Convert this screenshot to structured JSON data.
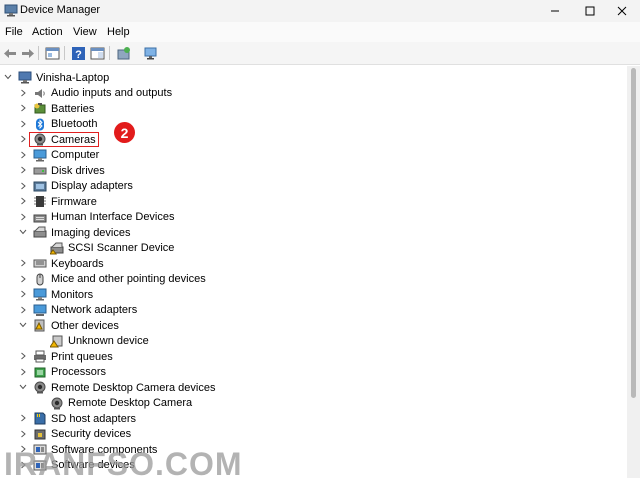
{
  "window": {
    "title": "Device Manager"
  },
  "menu": [
    "File",
    "Action",
    "View",
    "Help"
  ],
  "toolbar": [
    "back-arrow-icon",
    "forward-arrow-icon",
    "properties-pane-icon",
    "help-icon",
    "console-pane-icon",
    "update-driver-icon",
    "scan-hardware-icon"
  ],
  "tree": {
    "root": "Vinisha-Laptop",
    "items": [
      {
        "label": "Audio inputs and outputs",
        "icon": "speaker-icon"
      },
      {
        "label": "Batteries",
        "icon": "battery-icon"
      },
      {
        "label": "Bluetooth",
        "icon": "bluetooth-icon"
      },
      {
        "label": "Cameras",
        "icon": "camera-icon"
      },
      {
        "label": "Computer",
        "icon": "monitor-icon"
      },
      {
        "label": "Disk drives",
        "icon": "disk-icon"
      },
      {
        "label": "Display adapters",
        "icon": "display-adapter-icon"
      },
      {
        "label": "Firmware",
        "icon": "chip-icon"
      },
      {
        "label": "Human Interface Devices",
        "icon": "hid-icon"
      },
      {
        "label": "Imaging devices",
        "icon": "scanner-icon",
        "expanded": true
      },
      {
        "label": "SCSI Scanner Device",
        "icon": "scanner-device-icon",
        "child": true
      },
      {
        "label": "Keyboards",
        "icon": "keyboard-icon"
      },
      {
        "label": "Mice and other pointing devices",
        "icon": "mouse-icon"
      },
      {
        "label": "Monitors",
        "icon": "monitor-icon"
      },
      {
        "label": "Network adapters",
        "icon": "network-icon"
      },
      {
        "label": "Other devices",
        "icon": "other-device-icon",
        "expanded": true
      },
      {
        "label": "Unknown device",
        "icon": "warning-device-icon",
        "child": true
      },
      {
        "label": "Print queues",
        "icon": "printer-icon"
      },
      {
        "label": "Processors",
        "icon": "processor-icon"
      },
      {
        "label": "Remote Desktop Camera devices",
        "icon": "camera-icon",
        "expanded": true
      },
      {
        "label": "Remote Desktop Camera",
        "icon": "camera-icon",
        "child": true
      },
      {
        "label": "SD host adapters",
        "icon": "sd-card-icon"
      },
      {
        "label": "Security devices",
        "icon": "security-icon"
      },
      {
        "label": "Software components",
        "icon": "software-icon"
      },
      {
        "label": "Software devices",
        "icon": "software-icon"
      }
    ]
  },
  "annotation": {
    "step": "2"
  },
  "watermark": "IRANFSO.COM",
  "colors": {
    "highlight": "#e02020",
    "badge": "#e21b1b"
  }
}
